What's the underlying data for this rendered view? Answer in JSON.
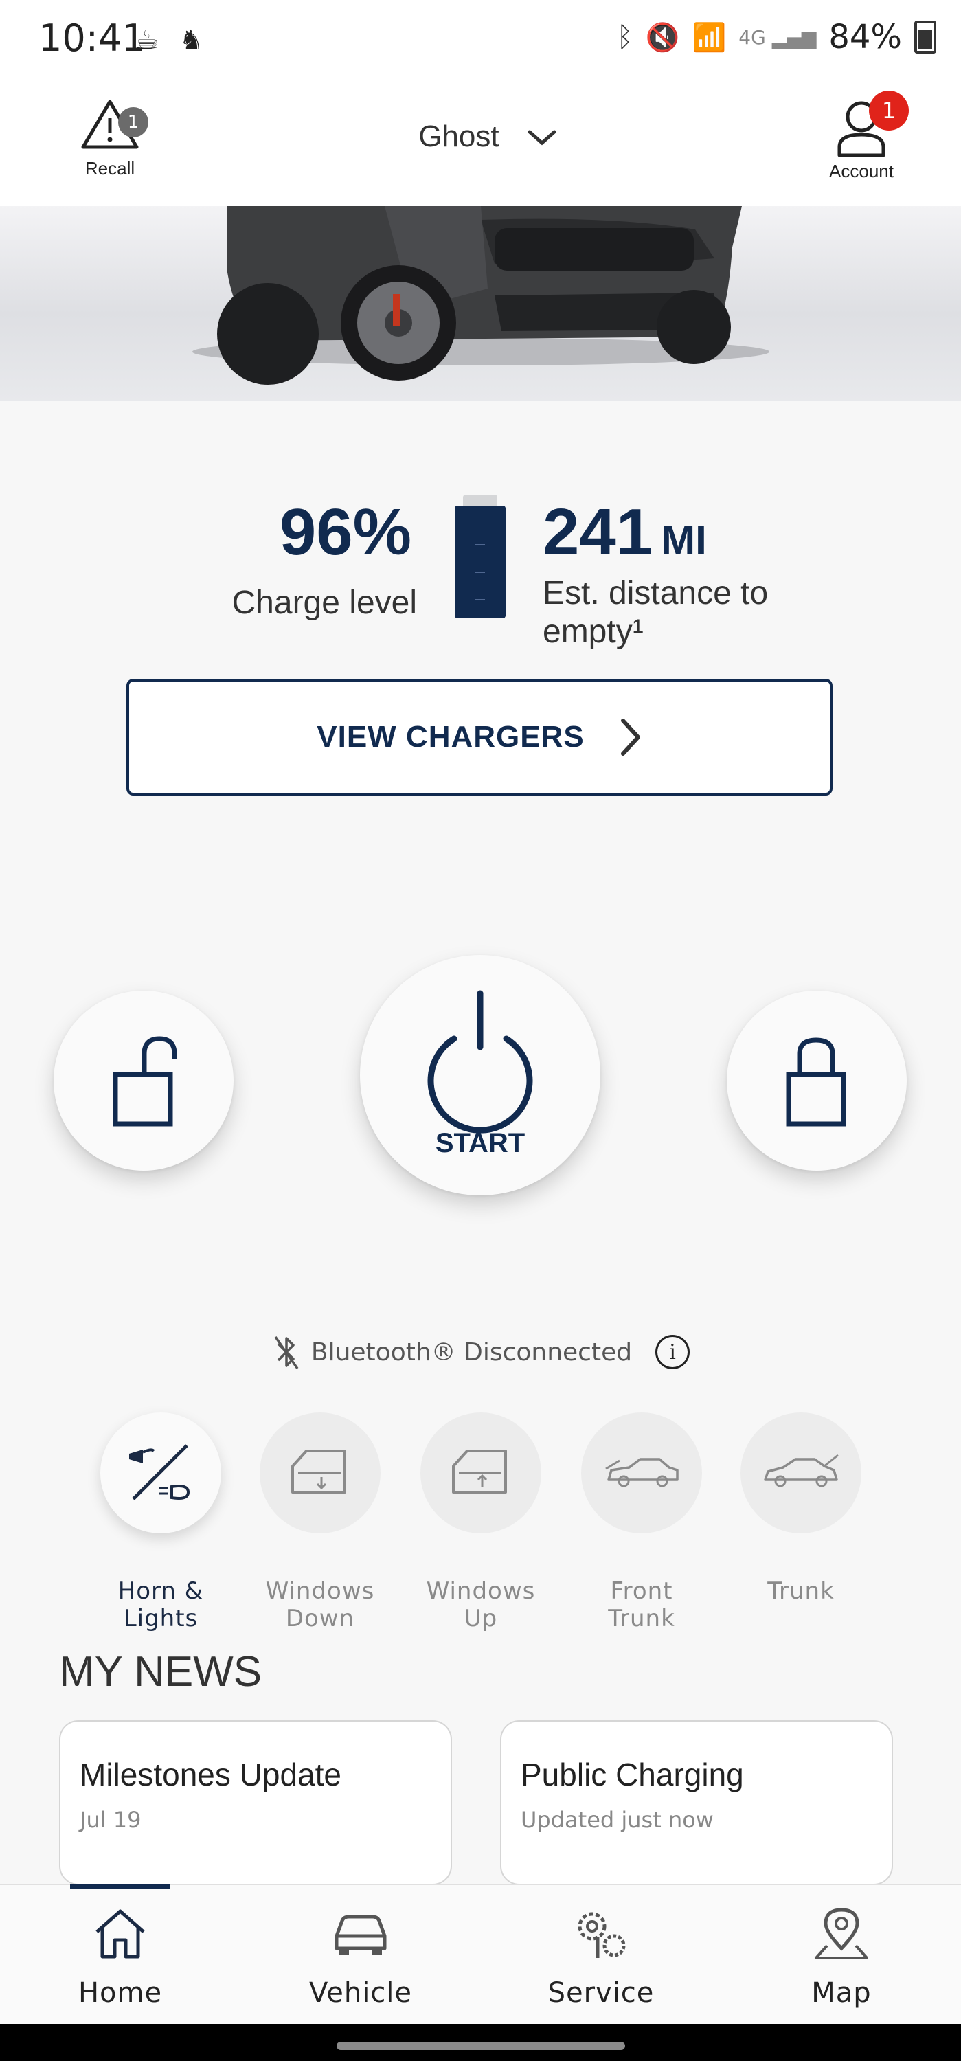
{
  "status_bar": {
    "time": "10:41",
    "battery_pct": "84%"
  },
  "header": {
    "recall_label": "Recall",
    "recall_count": "1",
    "vehicle_name": "Ghost",
    "account_label": "Account",
    "account_count": "1"
  },
  "charge": {
    "level": "96%",
    "level_label": "Charge level",
    "range_value": "241",
    "range_unit": "MI",
    "range_label": "Est. distance to empty¹"
  },
  "view_chargers_label": "VIEW CHARGERS",
  "remote": {
    "start_label": "START"
  },
  "bluetooth": {
    "status_text": "Bluetooth® Disconnected"
  },
  "quick_actions": [
    {
      "label": "Horn & Lights",
      "icon": "horn-lights-icon",
      "active": true
    },
    {
      "label": "Windows Down",
      "icon": "window-down-icon",
      "active": false
    },
    {
      "label": "Windows Up",
      "icon": "window-up-icon",
      "active": false
    },
    {
      "label": "Front Trunk",
      "icon": "front-trunk-icon",
      "active": false
    },
    {
      "label": "Trunk",
      "icon": "trunk-icon",
      "active": false
    }
  ],
  "news": {
    "title": "MY NEWS",
    "cards": [
      {
        "title": "Milestones Update",
        "subtitle": "Jul 19"
      },
      {
        "title": "Public Charging",
        "subtitle": "Updated just now"
      }
    ]
  },
  "bottom_nav": [
    {
      "label": "Home",
      "active": true
    },
    {
      "label": "Vehicle",
      "active": false
    },
    {
      "label": "Service",
      "active": false
    },
    {
      "label": "Map",
      "active": false
    }
  ],
  "colors": {
    "brand_navy": "#112a4f",
    "badge_red": "#e0231a",
    "badge_gray": "#6b6b6b"
  }
}
